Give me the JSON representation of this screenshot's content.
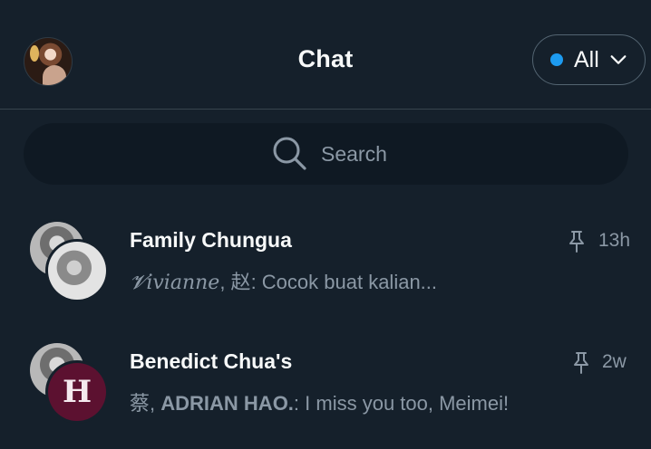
{
  "header": {
    "title": "Chat",
    "filter_label": "All",
    "filter_dot_color": "#1d9bf0",
    "profile_icon": "profile-avatar",
    "filter_icon": "chevron-down-icon"
  },
  "search": {
    "placeholder": "Search",
    "icon": "search-icon"
  },
  "chats": [
    {
      "name": "Family Chungua",
      "preview_sender": "𝓥ivianne",
      "preview_sender2": "赵",
      "preview_text": "Cocok buat kalian...",
      "time": "13h",
      "pinned": true,
      "pin_icon": "pin-icon"
    },
    {
      "name": "Benedict Chua's",
      "preview_sender": "蔡",
      "preview_sender2": "ADRIAN HAO.",
      "preview_text": "I miss you too, Meimei!",
      "time": "2w",
      "pinned": true,
      "pin_icon": "pin-icon"
    }
  ]
}
